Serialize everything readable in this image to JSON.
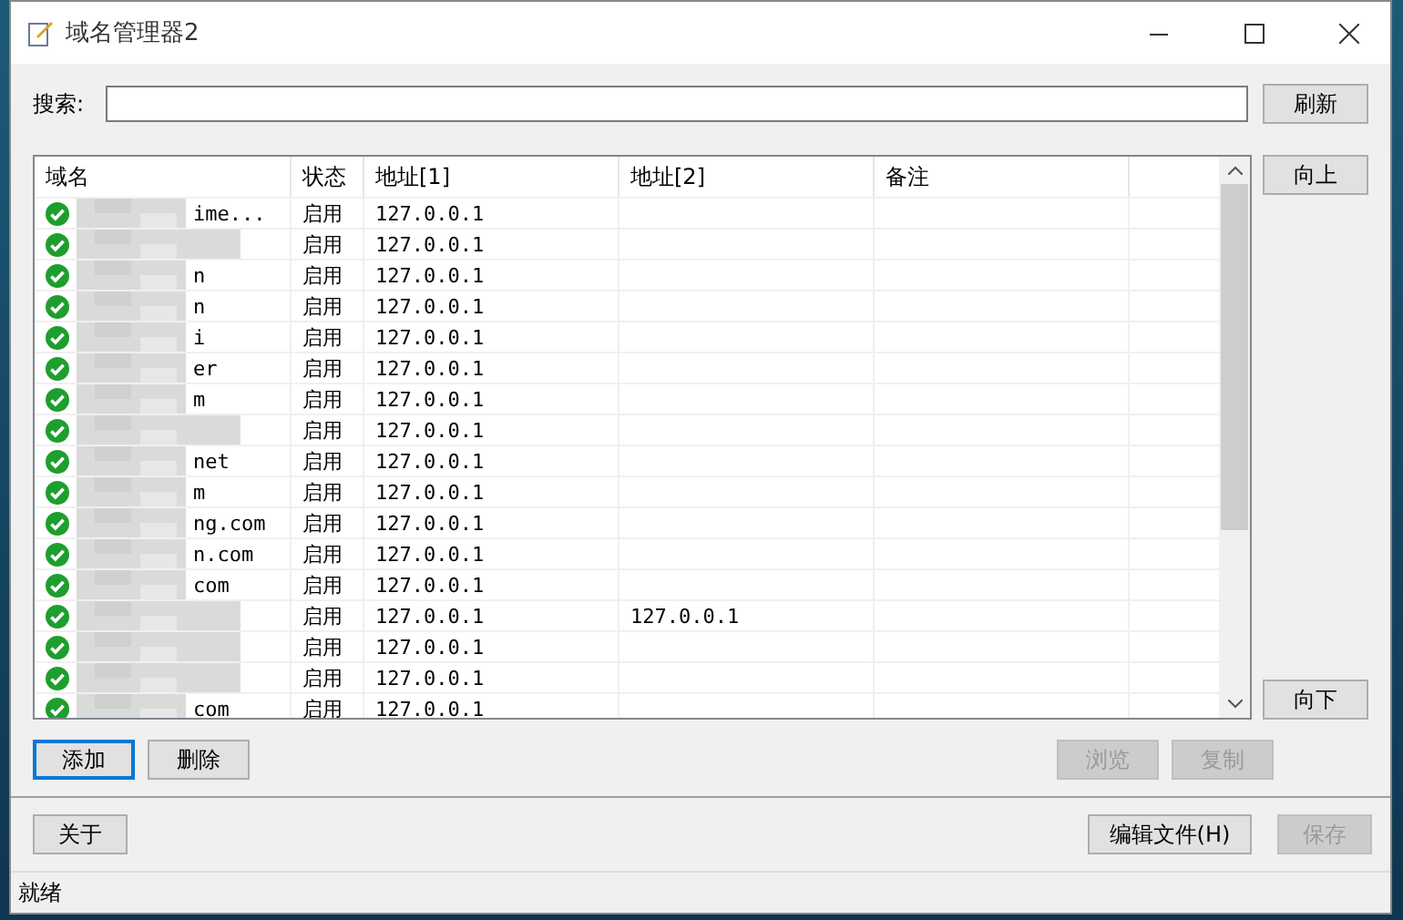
{
  "window": {
    "title": "域名管理器2"
  },
  "search": {
    "label": "搜索:",
    "button": "刷新"
  },
  "table": {
    "columns": [
      "域名",
      "状态",
      "地址[1]",
      "地址[2]",
      "备注"
    ],
    "rows": [
      {
        "domain": "ime...",
        "enabled": true,
        "status": "启用",
        "address_1": "127.0.0.1"
      },
      {
        "enabled": true,
        "status": "启用",
        "address_1": "127.0.0.1"
      },
      {
        "domain": "n",
        "enabled": true,
        "status": "启用",
        "address_1": "127.0.0.1"
      },
      {
        "domain": "n",
        "enabled": true,
        "status": "启用",
        "address_1": "127.0.0.1"
      },
      {
        "domain": "i",
        "enabled": true,
        "status": "启用",
        "address_1": "127.0.0.1"
      },
      {
        "domain": "er",
        "enabled": true,
        "status": "启用",
        "address_1": "127.0.0.1"
      },
      {
        "domain": "m",
        "enabled": true,
        "status": "启用",
        "address_1": "127.0.0.1"
      },
      {
        "enabled": true,
        "status": "启用",
        "address_1": "127.0.0.1"
      },
      {
        "domain": "net",
        "enabled": true,
        "status": "启用",
        "address_1": "127.0.0.1"
      },
      {
        "domain": "m",
        "enabled": true,
        "status": "启用",
        "address_1": "127.0.0.1"
      },
      {
        "domain": "ng.com",
        "enabled": true,
        "status": "启用",
        "address_1": "127.0.0.1"
      },
      {
        "domain": "n.com",
        "enabled": true,
        "status": "启用",
        "address_1": "127.0.0.1"
      },
      {
        "domain": "com",
        "enabled": true,
        "status": "启用",
        "address_1": "127.0.0.1"
      },
      {
        "enabled": true,
        "status": "启用",
        "address_1": "127.0.0.1",
        "address_2": "127.0.0.1"
      },
      {
        "enabled": true,
        "status": "启用",
        "address_1": "127.0.0.1"
      },
      {
        "enabled": true,
        "status": "启用",
        "address_1": "127.0.0.1"
      },
      {
        "domain": "com",
        "enabled": true,
        "status": "启用",
        "address_1": "127.0.0.1"
      }
    ]
  },
  "side_buttons": [
    "向上",
    "向下"
  ],
  "actions": [
    {
      "label": "添加",
      "disabled": false,
      "selected": true
    },
    {
      "label": "删除",
      "disabled": false,
      "selected": false
    },
    {
      "label": "浏览",
      "disabled": true,
      "selected": false
    },
    {
      "label": "复制",
      "disabled": true,
      "selected": false
    }
  ],
  "footer": [
    {
      "label": "关于",
      "disabled": false
    },
    {
      "label": "编辑文件(H)",
      "disabled": false
    },
    {
      "label": "保存",
      "disabled": true
    }
  ],
  "status_bar": "就绪"
}
